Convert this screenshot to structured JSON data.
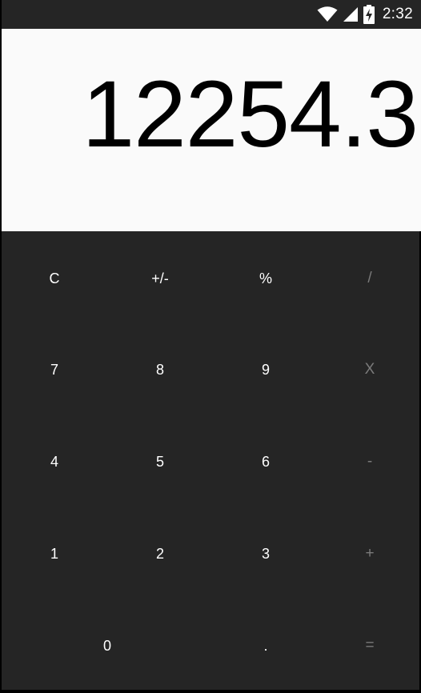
{
  "status_bar": {
    "time": "2:32",
    "icons": [
      "wifi-icon",
      "signal-icon",
      "battery-charging-icon"
    ]
  },
  "display": {
    "value": "12254.3"
  },
  "keys": {
    "clear": "C",
    "sign": "+/-",
    "percent": "%",
    "divide": "/",
    "seven": "7",
    "eight": "8",
    "nine": "9",
    "multiply": "X",
    "four": "4",
    "five": "5",
    "six": "6",
    "subtract": "-",
    "one": "1",
    "two": "2",
    "three": "3",
    "add": "+",
    "zero": "0",
    "decimal": ".",
    "equals": "="
  },
  "colors": {
    "keypad_background": "#252525",
    "display_background": "#fafafa",
    "digit_text": "#ffffff",
    "operator_text": "#7a7a7a"
  }
}
